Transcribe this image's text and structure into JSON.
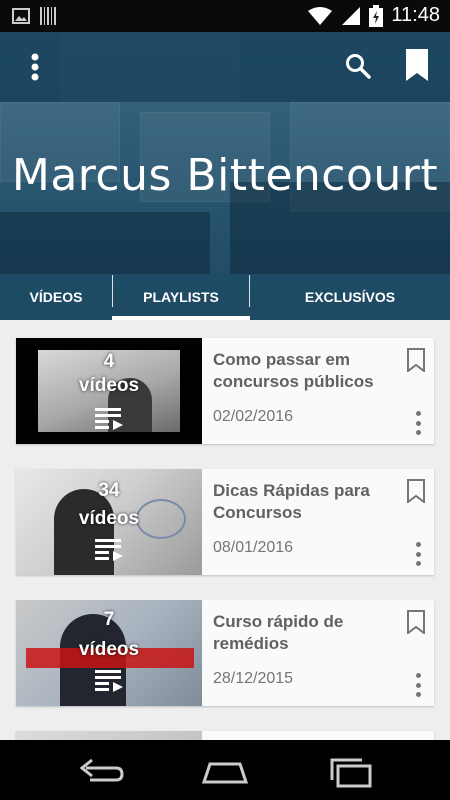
{
  "status_bar": {
    "time": "11:48"
  },
  "channel": {
    "title": "Marcus Bittencourt"
  },
  "tabs": [
    {
      "label": "VÍDEOS"
    },
    {
      "label": "PLAYLISTS"
    },
    {
      "label": "EXCLUSÍVOS"
    }
  ],
  "active_tab": "PLAYLISTS",
  "playlists": [
    {
      "count": "4",
      "unit": "vídeos",
      "title": "Como passar em concursos públicos",
      "date": "02/02/2016"
    },
    {
      "count": "34",
      "unit": "vídeos",
      "title": "Dicas Rápidas para Concursos",
      "date": "08/01/2016"
    },
    {
      "count": "7",
      "unit": "vídeos",
      "title": "Curso rápido de remédios",
      "date": "28/12/2015"
    }
  ],
  "icons": {
    "menu": "more-vert-icon",
    "search": "search-icon",
    "bookmark": "bookmark-icon",
    "playlist": "playlist-play-icon",
    "nav_back": "back-icon",
    "nav_home": "home-icon",
    "nav_recents": "recents-icon"
  },
  "colors": {
    "header": "#2d5a74",
    "content_bg": "#eeeeee",
    "card_title": "#616161"
  }
}
